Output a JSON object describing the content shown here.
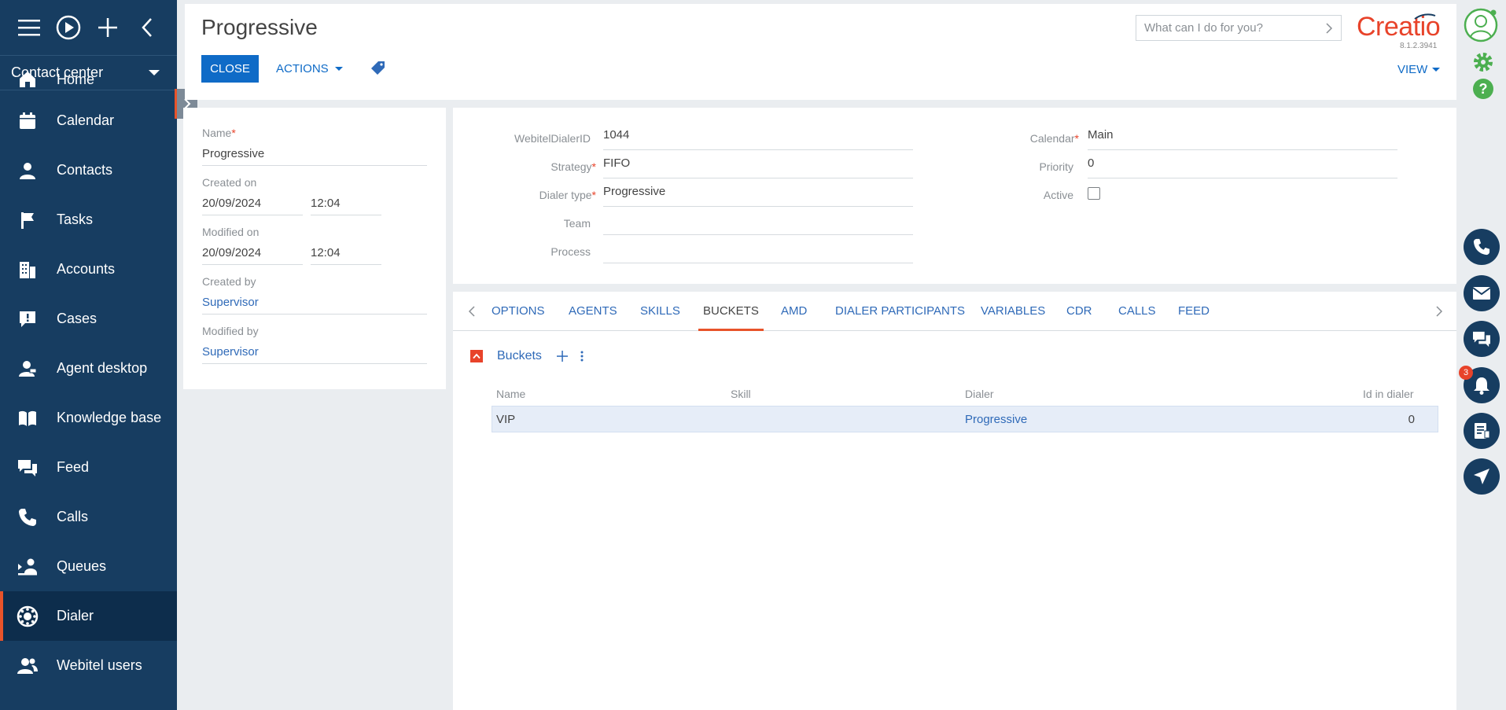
{
  "sidebar": {
    "workspace": "Contact center",
    "items": [
      {
        "label": "Home"
      },
      {
        "label": "Calendar"
      },
      {
        "label": "Contacts"
      },
      {
        "label": "Tasks"
      },
      {
        "label": "Accounts"
      },
      {
        "label": "Cases"
      },
      {
        "label": "Agent desktop"
      },
      {
        "label": "Knowledge base"
      },
      {
        "label": "Feed"
      },
      {
        "label": "Calls"
      },
      {
        "label": "Queues"
      },
      {
        "label": "Dialer"
      },
      {
        "label": "Webitel users"
      }
    ],
    "active": "Dialer"
  },
  "header": {
    "title": "Progressive",
    "close_label": "CLOSE",
    "actions_label": "ACTIONS",
    "search_placeholder": "What can I do for you?",
    "logo": "Creatio",
    "version": "8.1.2.3941",
    "view_label": "VIEW"
  },
  "info": {
    "name_label": "Name",
    "name_value": "Progressive",
    "created_on_label": "Created on",
    "created_on_date": "20/09/2024",
    "created_on_time": "12:04",
    "modified_on_label": "Modified on",
    "modified_on_date": "20/09/2024",
    "modified_on_time": "12:04",
    "created_by_label": "Created by",
    "created_by_value": "Supervisor",
    "modified_by_label": "Modified by",
    "modified_by_value": "Supervisor"
  },
  "form": {
    "dialer_id_label": "WebitelDialerID",
    "dialer_id_value": "1044",
    "strategy_label": "Strategy",
    "strategy_value": "FIFO",
    "dialer_type_label": "Dialer type",
    "dialer_type_value": "Progressive",
    "team_label": "Team",
    "team_value": "",
    "process_label": "Process",
    "process_value": "",
    "calendar_label": "Calendar",
    "calendar_value": "Main",
    "priority_label": "Priority",
    "priority_value": "0",
    "active_label": "Active",
    "active_checked": false
  },
  "tabs": [
    "OPTIONS",
    "AGENTS",
    "SKILLS",
    "BUCKETS",
    "AMD",
    "DIALER PARTICIPANTS",
    "VARIABLES",
    "CDR",
    "CALLS",
    "FEED"
  ],
  "active_tab": "BUCKETS",
  "buckets": {
    "title": "Buckets",
    "columns": [
      "Name",
      "Skill",
      "Dialer",
      "Id in dialer"
    ],
    "rows": [
      {
        "name": "VIP",
        "skill": "",
        "dialer": "Progressive",
        "id_in_dialer": "0"
      }
    ]
  },
  "notifications": {
    "count": "3"
  },
  "colors": {
    "sidebar": "#173d61",
    "accent": "#e8532a",
    "primary": "#0f6bc7",
    "link": "#2f6ab8"
  }
}
